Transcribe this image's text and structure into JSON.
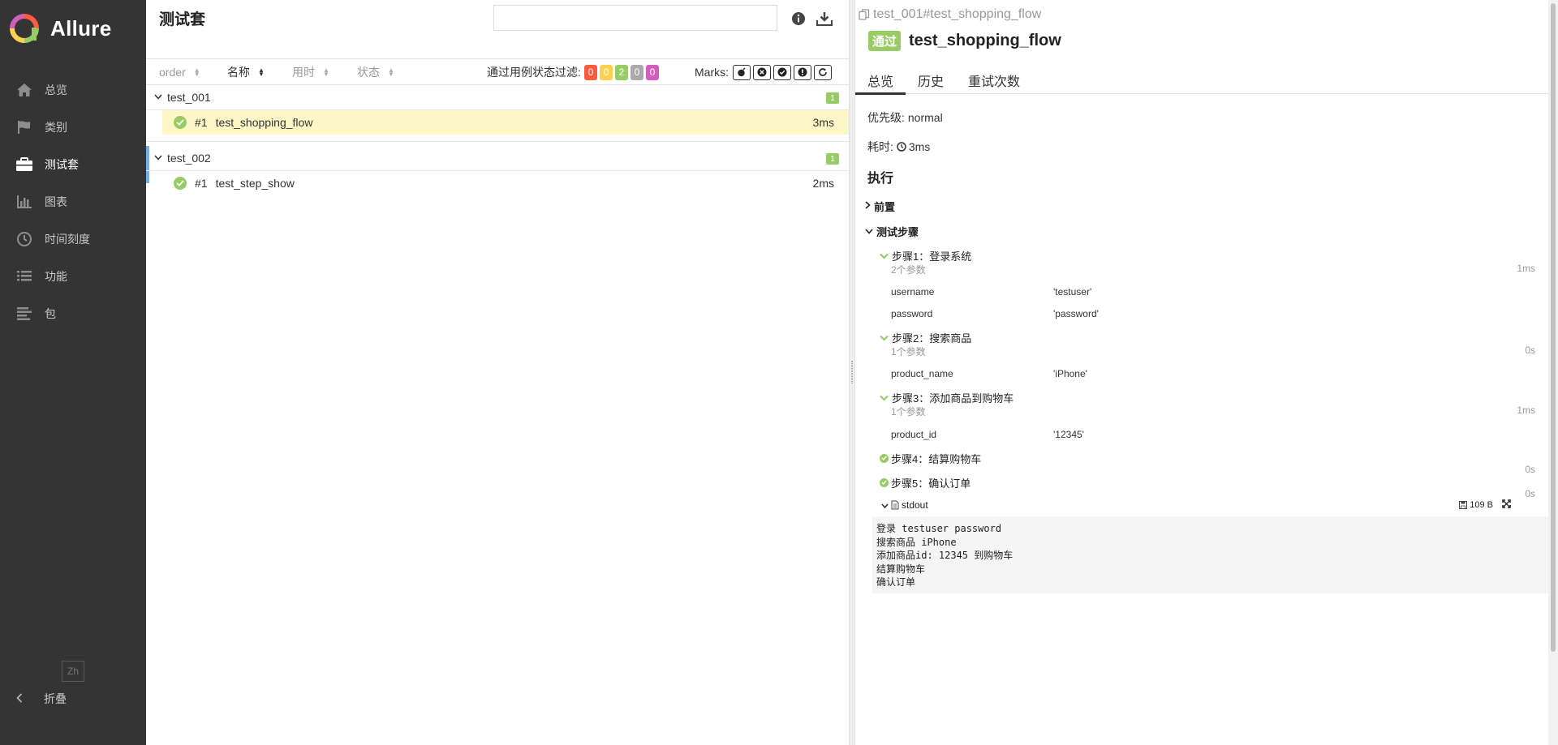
{
  "brand": {
    "name": "Allure"
  },
  "sidebar": {
    "items": [
      {
        "label": "总览",
        "icon": "home-icon"
      },
      {
        "label": "类别",
        "icon": "flag-icon"
      },
      {
        "label": "测试套",
        "icon": "briefcase-icon",
        "active": true
      },
      {
        "label": "图表",
        "icon": "bar-chart-icon"
      },
      {
        "label": "时间刻度",
        "icon": "clock-icon"
      },
      {
        "label": "功能",
        "icon": "list-icon"
      },
      {
        "label": "包",
        "icon": "align-left-icon"
      }
    ],
    "language": "Zh",
    "collapse_label": "折叠"
  },
  "suites": {
    "title": "测试套",
    "search_placeholder": "",
    "sort_columns": [
      "order",
      "名称",
      "用时",
      "状态"
    ],
    "filter_label": "通过用例状态过滤:",
    "status_badges": [
      {
        "value": "0",
        "color": "#fd5a3e"
      },
      {
        "value": "0",
        "color": "#ffd050"
      },
      {
        "value": "2",
        "color": "#97cc64"
      },
      {
        "value": "0",
        "color": "#aaaaaa"
      },
      {
        "value": "0",
        "color": "#d35ebe"
      }
    ],
    "marks_label": "Marks:",
    "groups": [
      {
        "name": "test_001",
        "count": "1",
        "tests": [
          {
            "num": "#1",
            "name": "test_shopping_flow",
            "duration": "3ms",
            "selected": true
          }
        ]
      },
      {
        "name": "test_002",
        "count": "1",
        "tests": [
          {
            "num": "#1",
            "name": "test_step_show",
            "duration": "2ms"
          }
        ]
      }
    ]
  },
  "detail": {
    "breadcrumb": "test_001#test_shopping_flow",
    "status": "通过",
    "name": "test_shopping_flow",
    "tabs": [
      "总览",
      "历史",
      "重试次数"
    ],
    "priority_label": "优先级:",
    "priority_value": "normal",
    "duration_label": "耗时:",
    "duration_value": "3ms",
    "execution_title": "执行",
    "setup_label": "前置",
    "steps_label": "测试步骤",
    "steps": [
      {
        "title": "步骤1：登录系统",
        "sub": "2个参数",
        "duration": "1ms",
        "params": [
          {
            "name": "username",
            "value": "'testuser'"
          },
          {
            "name": "password",
            "value": "'password'"
          }
        ]
      },
      {
        "title": "步骤2：搜索商品",
        "sub": "1个参数",
        "duration": "0s",
        "params": [
          {
            "name": "product_name",
            "value": "'iPhone'"
          }
        ]
      },
      {
        "title": "步骤3：添加商品到购物车",
        "sub": "1个参数",
        "duration": "1ms",
        "params": [
          {
            "name": "product_id",
            "value": "'12345'"
          }
        ]
      },
      {
        "title": "步骤4：结算购物车",
        "duration": "0s"
      },
      {
        "title": "步骤5：确认订单",
        "duration": "0s"
      }
    ],
    "stdout": {
      "label": "stdout",
      "size": "109 B",
      "content": "登录 testuser password\n搜索商品 iPhone\n添加商品id: 12345 到购物车\n结算购物车\n确认订单"
    }
  }
}
